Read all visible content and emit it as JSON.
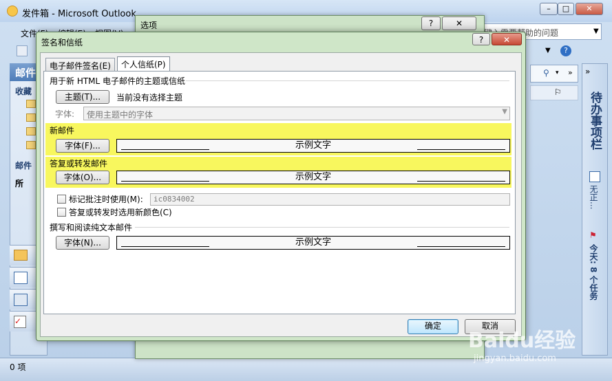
{
  "outlook": {
    "window_title": "发件箱 - Microsoft Outlook",
    "menu": [
      "文件(F)",
      "编辑(E)",
      "视图(V)"
    ],
    "help_placeholder": "键入需要帮助的问题",
    "nav": {
      "header": "邮件",
      "favorites": "收藏",
      "mail_folders": "邮件",
      "all_items": "所"
    },
    "todo_bar": {
      "title": "待办事项栏",
      "no_appointments": "无正...",
      "tasks": "今天: 8 个任务"
    },
    "status": "0 项"
  },
  "options_dialog": {
    "title": "选项"
  },
  "signature_dialog": {
    "title": "签名和信纸",
    "tabs": [
      "电子邮件签名(E)",
      "个人信纸(P)"
    ],
    "theme_section": "用于新 HTML 电子邮件的主题或信纸",
    "theme_button": "主题(T)...",
    "no_theme_text": "当前没有选择主题",
    "font_label": "字体:",
    "font_combo": "使用主题中的字体",
    "new_mail_section": "新邮件",
    "reply_section": "答复或转发邮件",
    "plain_section": "撰写和阅读纯文本邮件",
    "font_button_new": "字体(F)...",
    "font_button_reply": "字体(O)...",
    "font_button_plain": "字体(N)...",
    "sample_text": "示例文字",
    "mark_comments_label": "标记批注时使用(M):",
    "mark_comments_value": "ic0834002",
    "pick_color_label": "答复或转发时选用新颜色(C)",
    "ok": "确定",
    "cancel": "取消"
  },
  "watermark": {
    "text": "Baidu经验",
    "url": "jingyan.baidu.com"
  },
  "colors": {
    "highlight": "#f8f75e",
    "dialog_frame": "#cfe6c8",
    "ok_border": "#3c7fb1"
  }
}
